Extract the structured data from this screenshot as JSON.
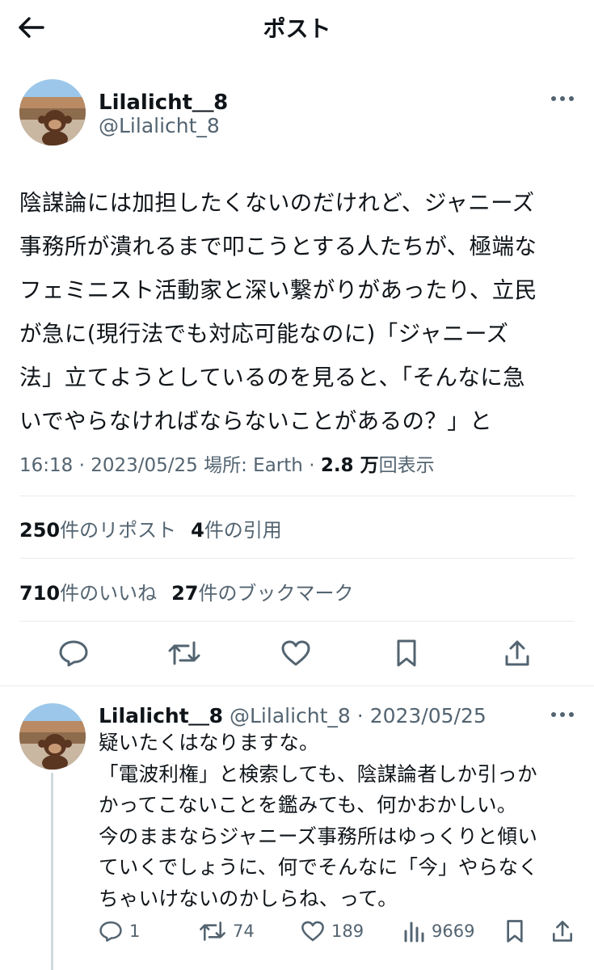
{
  "header": {
    "title": "ポスト"
  },
  "post": {
    "author_name": "Lilalicht＿8",
    "author_handle": "@Lilalicht_8",
    "text": "陰謀論には加担したくないのだけれど、ジャニーズ\n事務所が潰れるまで叩こうとする人たちが、極端な\nフェミニスト活動家と深い繋がりがあったり、立民\nが急に(現行法でも対応可能なのに)「ジャニーズ\n法」立てようとしているのを見ると、「そんなに急\nいでやらなければならないことがあるの？」と",
    "time": "16:18",
    "date": "2023/05/25",
    "location": "場所: Earth",
    "views": "2.8 万",
    "views_label": "回表示",
    "reposts_count": "250",
    "reposts_label": "件のリポスト",
    "quotes_count": "4",
    "quotes_label": "件の引用",
    "likes_count": "710",
    "likes_label": "件のいいね",
    "bookmarks_count": "27",
    "bookmarks_label": "件のブックマーク"
  },
  "reply": {
    "author_name": "Lilalicht＿8",
    "author_handle": "@Lilalicht_8",
    "date": "2023/05/25",
    "text": "疑いたくはなりますな。\n「電波利権」と検索しても、陰謀論者しか引っか\nかってこないことを鑑みても、何かおかしい。\n今のままならジャニーズ事務所はゆっくりと傾い\nていくでしょうに、何でそんなに「今」やらなく\nちゃいけないのかしらね、って。",
    "replies": "1",
    "reposts": "74",
    "likes": "189",
    "views": "9669"
  },
  "icons": [
    "back-arrow-icon",
    "more-icon",
    "reply-icon",
    "repost-icon",
    "like-icon",
    "bookmark-icon",
    "share-icon",
    "views-icon"
  ],
  "colors": {
    "text": "#0f1419",
    "secondary": "#536471",
    "divider": "#e6ecf0"
  }
}
